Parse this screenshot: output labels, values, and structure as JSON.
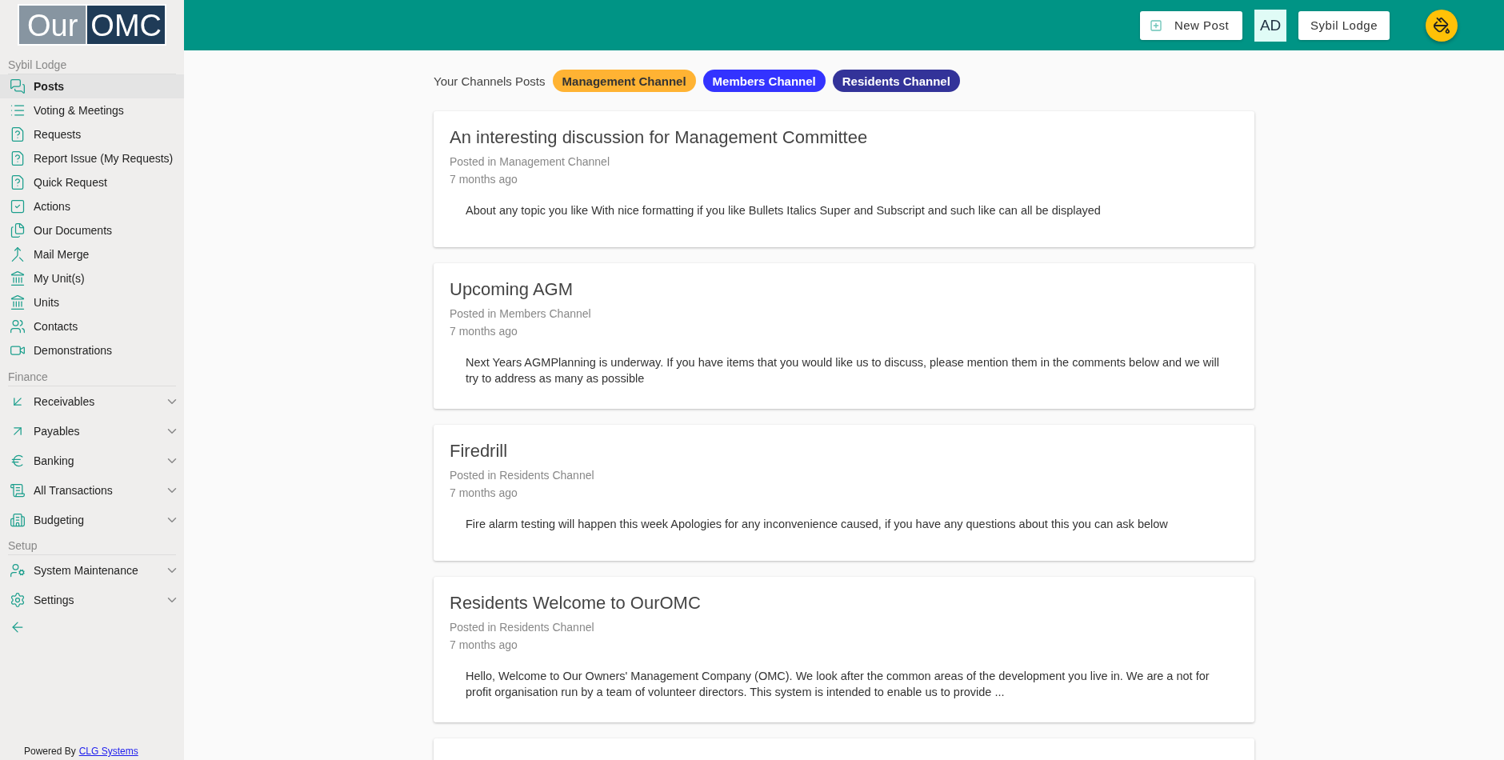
{
  "logo": {
    "left": "Our",
    "right": "OMC"
  },
  "sidebar": {
    "sections": [
      {
        "heading": "Sybil Lodge",
        "items": [
          {
            "label": "Posts",
            "selected": true,
            "expandable": false
          },
          {
            "label": "Voting & Meetings",
            "selected": false,
            "expandable": false
          },
          {
            "label": "Requests",
            "selected": false,
            "expandable": false
          },
          {
            "label": "Report Issue (My Requests)",
            "selected": false,
            "expandable": false
          },
          {
            "label": "Quick Request",
            "selected": false,
            "expandable": false
          },
          {
            "label": "Actions",
            "selected": false,
            "expandable": false
          },
          {
            "label": "Our Documents",
            "selected": false,
            "expandable": false
          },
          {
            "label": "Mail Merge",
            "selected": false,
            "expandable": false
          },
          {
            "label": "My Unit(s)",
            "selected": false,
            "expandable": false
          },
          {
            "label": "Units",
            "selected": false,
            "expandable": false
          },
          {
            "label": "Contacts",
            "selected": false,
            "expandable": false
          },
          {
            "label": "Demonstrations",
            "selected": false,
            "expandable": false
          }
        ]
      },
      {
        "heading": "Finance",
        "items": [
          {
            "label": "Receivables",
            "selected": false,
            "expandable": true
          },
          {
            "label": "Payables",
            "selected": false,
            "expandable": true
          },
          {
            "label": "Banking",
            "selected": false,
            "expandable": true
          },
          {
            "label": "All Transactions",
            "selected": false,
            "expandable": true
          },
          {
            "label": "Budgeting",
            "selected": false,
            "expandable": true
          }
        ]
      },
      {
        "heading": "Setup",
        "items": [
          {
            "label": "System Maintenance",
            "selected": false,
            "expandable": true
          },
          {
            "label": "Settings",
            "selected": false,
            "expandable": true
          }
        ]
      }
    ],
    "footer": {
      "text": "Powered By",
      "link": "CLG Systems"
    }
  },
  "header": {
    "new_post": "New Post",
    "initials": "AD",
    "account": "Sybil Lodge"
  },
  "channels": {
    "label": "Your Channels Posts",
    "items": [
      {
        "label": "Management Channel",
        "color": "#ffb333"
      },
      {
        "label": "Members Channel",
        "color": "#3333ff"
      },
      {
        "label": "Residents Channel",
        "color": "#333399"
      }
    ]
  },
  "posts": [
    {
      "title": "An interesting discussion for Management Committee",
      "channel": "Posted in Management Channel",
      "time": "7 months ago",
      "body": "About any topic you like With nice formatting if you like Bullets Italics Super and Subscript and such like can all be displayed"
    },
    {
      "title": "Upcoming AGM",
      "channel": "Posted in Members Channel",
      "time": "7 months ago",
      "body": "Next Years AGMPlanning is underway. If you have items that you would like us to discuss, please mention them in the comments below and we will try to address as many as possible"
    },
    {
      "title": "Firedrill",
      "channel": "Posted in Residents Channel",
      "time": "7 months ago",
      "body": "Fire alarm testing will happen this week Apologies for any inconvenience caused, if you have any questions about this you can ask below"
    },
    {
      "title": "Residents Welcome to OurOMC",
      "channel": "Posted in Residents Channel",
      "time": "7 months ago",
      "body": "Hello, Welcome to Our Owners' Management Company (OMC). We look after the common areas of the development you live in. We are a not for profit organisation run by a team of volunteer directors. This system is intended to enable us to provide ..."
    }
  ]
}
